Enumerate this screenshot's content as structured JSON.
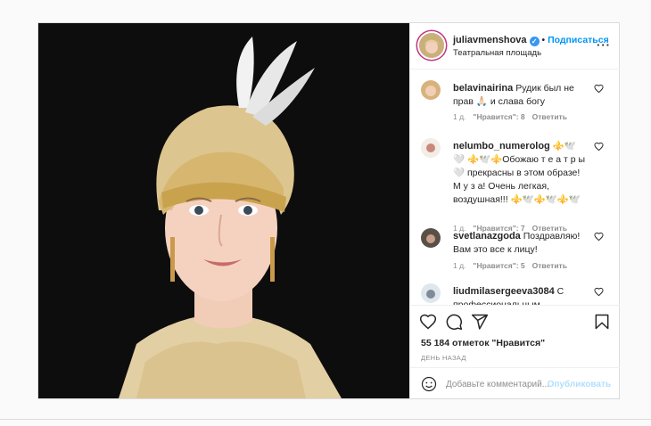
{
  "post": {
    "username": "juliavmenshova",
    "verified_icon": "verified-badge-icon",
    "separator": "•",
    "follow_label": "Подписаться",
    "location": "Театральная площадь",
    "more_icon": "more-options-icon",
    "more_text": "···"
  },
  "comments": [
    {
      "username": "belavinairina",
      "text": "Рудик был не прав 🙏🏻 и слава богу",
      "age": "1 д.",
      "likes": "\"Нравится\": 8",
      "reply": "Ответить"
    },
    {
      "username": "nelumbo_numerolog",
      "text": "⚜️🕊️🤍 ⚜️🕊️⚜️Обожаю т е а т р ы 🤍 прекрасны в этом образе! М у з а! Очень легкая, воздушная!!! ⚜️🕊️⚜️🕊️⚜️🕊️",
      "age": "1 д.",
      "likes": "\"Нравится\": 7",
      "reply": "Ответить"
    },
    {
      "username": "svetlanazgoda",
      "text": "Поздравляю! Вам это все к лицу!",
      "age": "1 д.",
      "likes": "\"Нравится\": 5",
      "reply": "Ответить"
    },
    {
      "username": "liudmilasergeeva3084",
      "text": "С профессиональным праздником",
      "age": "",
      "likes": "",
      "reply": ""
    }
  ],
  "actions": {
    "like_icon": "heart-icon",
    "comment_icon": "comment-icon",
    "share_icon": "share-icon",
    "save_icon": "bookmark-icon"
  },
  "likes_text": "55 184 отметок \"Нравится\"",
  "date_text": "день назад",
  "add_comment": {
    "placeholder": "Добавьте комментарий...",
    "emoji_icon": "emoji-icon",
    "publish_label": "Опубликовать"
  },
  "colors": {
    "accent": "#0095f6",
    "publish_disabled": "#b2dffc",
    "muted": "#8e8e8e",
    "photo_bg": "#0d0d0d"
  }
}
